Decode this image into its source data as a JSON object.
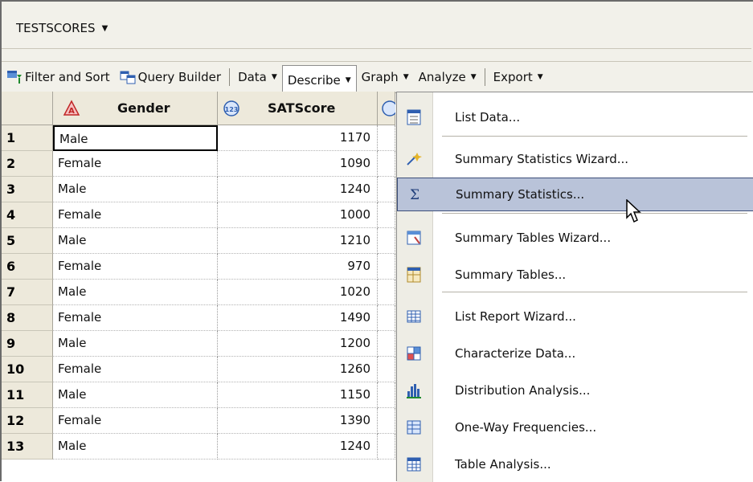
{
  "dataset": {
    "title": "TESTSCORES"
  },
  "toolbar": {
    "filter_sort": "Filter and Sort",
    "query_builder": "Query Builder",
    "data": "Data",
    "describe": "Describe",
    "graph": "Graph",
    "analyze": "Analyze",
    "export": "Export"
  },
  "columns": {
    "gender": "Gender",
    "satscore": "SATScore"
  },
  "rows": [
    {
      "n": "1",
      "gender": "Male",
      "score": "1170"
    },
    {
      "n": "2",
      "gender": "Female",
      "score": "1090"
    },
    {
      "n": "3",
      "gender": "Male",
      "score": "1240"
    },
    {
      "n": "4",
      "gender": "Female",
      "score": "1000"
    },
    {
      "n": "5",
      "gender": "Male",
      "score": "1210"
    },
    {
      "n": "6",
      "gender": "Female",
      "score": "970"
    },
    {
      "n": "7",
      "gender": "Male",
      "score": "1020"
    },
    {
      "n": "8",
      "gender": "Female",
      "score": "1490"
    },
    {
      "n": "9",
      "gender": "Male",
      "score": "1200"
    },
    {
      "n": "10",
      "gender": "Female",
      "score": "1260"
    },
    {
      "n": "11",
      "gender": "Male",
      "score": "1150"
    },
    {
      "n": "12",
      "gender": "Female",
      "score": "1390"
    },
    {
      "n": "13",
      "gender": "Male",
      "score": "1240"
    }
  ],
  "describe_menu": {
    "items": [
      {
        "label": "List Data...",
        "icon": "list-data-icon"
      },
      {
        "label": "Summary Statistics Wizard...",
        "icon": "wizard-icon"
      },
      {
        "label": "Summary Statistics...",
        "icon": "sigma-icon"
      },
      {
        "label": "Summary Tables Wizard...",
        "icon": "table-wizard-icon"
      },
      {
        "label": "Summary Tables...",
        "icon": "summary-tables-icon"
      },
      {
        "label": "List Report Wizard...",
        "icon": "list-report-icon"
      },
      {
        "label": "Characterize Data...",
        "icon": "characterize-icon"
      },
      {
        "label": "Distribution Analysis...",
        "icon": "distribution-icon"
      },
      {
        "label": "One-Way Frequencies...",
        "icon": "frequencies-icon"
      },
      {
        "label": "Table Analysis...",
        "icon": "table-analysis-icon"
      }
    ],
    "highlighted": "Summary Statistics..."
  },
  "colors": {
    "menu_highlight": "#b9c3d9",
    "header_bg": "#ede9db",
    "chrome_bg": "#f2f1ea"
  }
}
